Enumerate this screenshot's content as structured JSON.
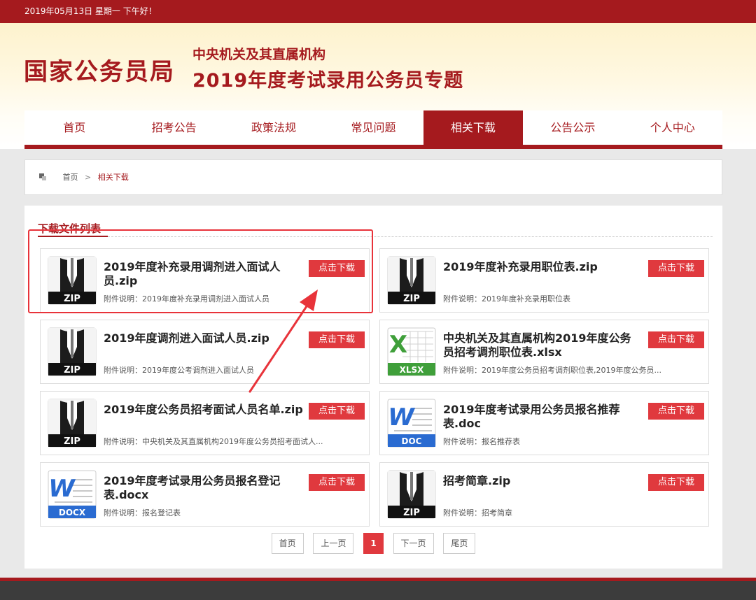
{
  "topbar": {
    "greeting": "2019年05月13日 星期一 下午好！"
  },
  "header": {
    "logo": "国家公务员局",
    "subtitle1": "中央机关及其直属机构",
    "subtitle2": "2019年度考试录用公务员专题"
  },
  "nav": {
    "items": [
      "首页",
      "招考公告",
      "政策法规",
      "常见问题",
      "相关下载",
      "公告公示",
      "个人中心"
    ],
    "active": "相关下载"
  },
  "breadcrumb": {
    "home": "首页",
    "separator": ">",
    "current": "相关下载"
  },
  "panel": {
    "title": "下载文件列表",
    "download_label": "点击下载"
  },
  "files": [
    {
      "name": "2019年度补充录用调剂进入面试人员.zip",
      "desc": "附件说明：2019年度补充录用调剂进入面试人员",
      "type": "ZIP"
    },
    {
      "name": "2019年度补充录用职位表.zip",
      "desc": "附件说明：2019年度补充录用职位表",
      "type": "ZIP"
    },
    {
      "name": "2019年度调剂进入面试人员.zip",
      "desc": "附件说明：2019年度公考调剂进入面试人员",
      "type": "ZIP"
    },
    {
      "name": "中央机关及其直属机构2019年度公务员招考调剂职位表.xlsx",
      "desc": "附件说明：2019年度公务员招考调剂职位表,2019年度公务员...",
      "type": "XLSX"
    },
    {
      "name": "2019年度公务员招考面试人员名单.zip",
      "desc": "附件说明：中央机关及其直属机构2019年度公务员招考面试人...",
      "type": "ZIP"
    },
    {
      "name": "2019年度考试录用公务员报名推荐表.doc",
      "desc": "附件说明：报名推荐表",
      "type": "DOC"
    },
    {
      "name": "2019年度考试录用公务员报名登记表.docx",
      "desc": "附件说明：报名登记表",
      "type": "DOCX"
    },
    {
      "name": "招考简章.zip",
      "desc": "附件说明：招考简章",
      "type": "ZIP"
    }
  ],
  "pager": {
    "first": "首页",
    "prev": "上一页",
    "current": "1",
    "next": "下一页",
    "last": "尾页"
  },
  "colors": {
    "brand": "#a51a1e",
    "button": "#e0393e",
    "annotation": "#e8333a",
    "excel": "#3f9f3a",
    "word": "#2a6bd1"
  },
  "icons": {
    "ZIP": "zip-file-icon",
    "XLSX": "excel-file-icon",
    "DOC": "word-file-icon",
    "DOCX": "word-file-icon"
  }
}
